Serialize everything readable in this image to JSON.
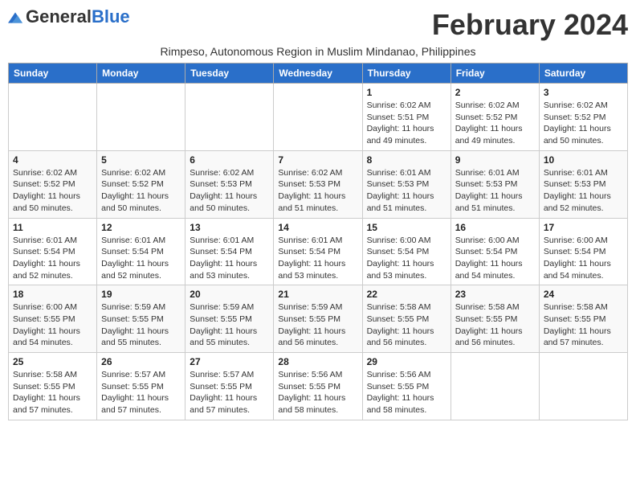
{
  "header": {
    "logo_general": "General",
    "logo_blue": "Blue",
    "month_title": "February 2024",
    "subtitle": "Rimpeso, Autonomous Region in Muslim Mindanao, Philippines"
  },
  "days_of_week": [
    "Sunday",
    "Monday",
    "Tuesday",
    "Wednesday",
    "Thursday",
    "Friday",
    "Saturday"
  ],
  "weeks": [
    {
      "days": [
        {
          "num": "",
          "info": ""
        },
        {
          "num": "",
          "info": ""
        },
        {
          "num": "",
          "info": ""
        },
        {
          "num": "",
          "info": ""
        },
        {
          "num": "1",
          "info": "Sunrise: 6:02 AM\nSunset: 5:51 PM\nDaylight: 11 hours and 49 minutes."
        },
        {
          "num": "2",
          "info": "Sunrise: 6:02 AM\nSunset: 5:52 PM\nDaylight: 11 hours and 49 minutes."
        },
        {
          "num": "3",
          "info": "Sunrise: 6:02 AM\nSunset: 5:52 PM\nDaylight: 11 hours and 50 minutes."
        }
      ]
    },
    {
      "days": [
        {
          "num": "4",
          "info": "Sunrise: 6:02 AM\nSunset: 5:52 PM\nDaylight: 11 hours and 50 minutes."
        },
        {
          "num": "5",
          "info": "Sunrise: 6:02 AM\nSunset: 5:52 PM\nDaylight: 11 hours and 50 minutes."
        },
        {
          "num": "6",
          "info": "Sunrise: 6:02 AM\nSunset: 5:53 PM\nDaylight: 11 hours and 50 minutes."
        },
        {
          "num": "7",
          "info": "Sunrise: 6:02 AM\nSunset: 5:53 PM\nDaylight: 11 hours and 51 minutes."
        },
        {
          "num": "8",
          "info": "Sunrise: 6:01 AM\nSunset: 5:53 PM\nDaylight: 11 hours and 51 minutes."
        },
        {
          "num": "9",
          "info": "Sunrise: 6:01 AM\nSunset: 5:53 PM\nDaylight: 11 hours and 51 minutes."
        },
        {
          "num": "10",
          "info": "Sunrise: 6:01 AM\nSunset: 5:53 PM\nDaylight: 11 hours and 52 minutes."
        }
      ]
    },
    {
      "days": [
        {
          "num": "11",
          "info": "Sunrise: 6:01 AM\nSunset: 5:54 PM\nDaylight: 11 hours and 52 minutes."
        },
        {
          "num": "12",
          "info": "Sunrise: 6:01 AM\nSunset: 5:54 PM\nDaylight: 11 hours and 52 minutes."
        },
        {
          "num": "13",
          "info": "Sunrise: 6:01 AM\nSunset: 5:54 PM\nDaylight: 11 hours and 53 minutes."
        },
        {
          "num": "14",
          "info": "Sunrise: 6:01 AM\nSunset: 5:54 PM\nDaylight: 11 hours and 53 minutes."
        },
        {
          "num": "15",
          "info": "Sunrise: 6:00 AM\nSunset: 5:54 PM\nDaylight: 11 hours and 53 minutes."
        },
        {
          "num": "16",
          "info": "Sunrise: 6:00 AM\nSunset: 5:54 PM\nDaylight: 11 hours and 54 minutes."
        },
        {
          "num": "17",
          "info": "Sunrise: 6:00 AM\nSunset: 5:54 PM\nDaylight: 11 hours and 54 minutes."
        }
      ]
    },
    {
      "days": [
        {
          "num": "18",
          "info": "Sunrise: 6:00 AM\nSunset: 5:55 PM\nDaylight: 11 hours and 54 minutes."
        },
        {
          "num": "19",
          "info": "Sunrise: 5:59 AM\nSunset: 5:55 PM\nDaylight: 11 hours and 55 minutes."
        },
        {
          "num": "20",
          "info": "Sunrise: 5:59 AM\nSunset: 5:55 PM\nDaylight: 11 hours and 55 minutes."
        },
        {
          "num": "21",
          "info": "Sunrise: 5:59 AM\nSunset: 5:55 PM\nDaylight: 11 hours and 56 minutes."
        },
        {
          "num": "22",
          "info": "Sunrise: 5:58 AM\nSunset: 5:55 PM\nDaylight: 11 hours and 56 minutes."
        },
        {
          "num": "23",
          "info": "Sunrise: 5:58 AM\nSunset: 5:55 PM\nDaylight: 11 hours and 56 minutes."
        },
        {
          "num": "24",
          "info": "Sunrise: 5:58 AM\nSunset: 5:55 PM\nDaylight: 11 hours and 57 minutes."
        }
      ]
    },
    {
      "days": [
        {
          "num": "25",
          "info": "Sunrise: 5:58 AM\nSunset: 5:55 PM\nDaylight: 11 hours and 57 minutes."
        },
        {
          "num": "26",
          "info": "Sunrise: 5:57 AM\nSunset: 5:55 PM\nDaylight: 11 hours and 57 minutes."
        },
        {
          "num": "27",
          "info": "Sunrise: 5:57 AM\nSunset: 5:55 PM\nDaylight: 11 hours and 57 minutes."
        },
        {
          "num": "28",
          "info": "Sunrise: 5:56 AM\nSunset: 5:55 PM\nDaylight: 11 hours and 58 minutes."
        },
        {
          "num": "29",
          "info": "Sunrise: 5:56 AM\nSunset: 5:55 PM\nDaylight: 11 hours and 58 minutes."
        },
        {
          "num": "",
          "info": ""
        },
        {
          "num": "",
          "info": ""
        }
      ]
    }
  ]
}
